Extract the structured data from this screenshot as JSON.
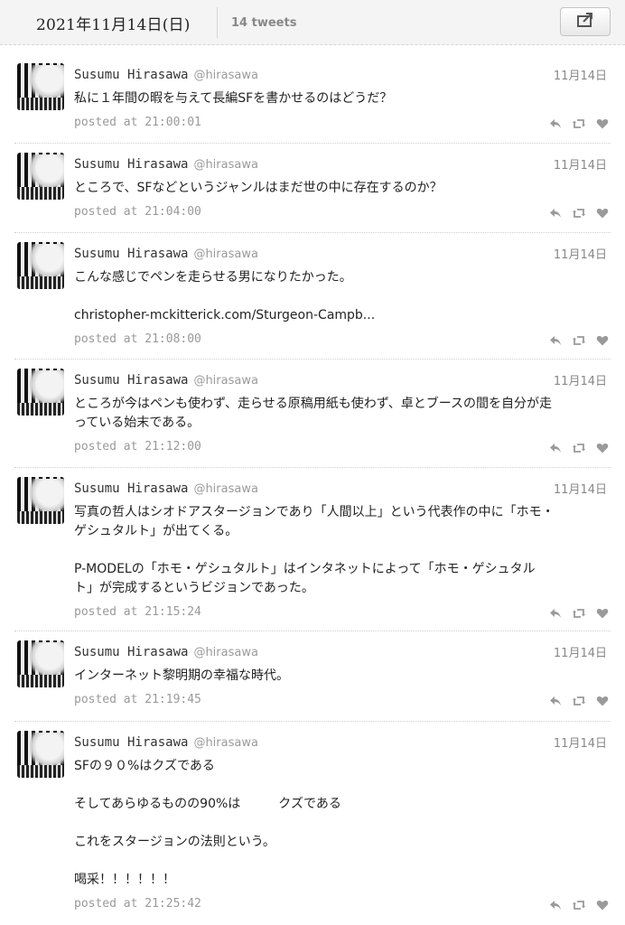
{
  "header": {
    "date_title": "2021年11月14日(日)",
    "tweet_count": "14 tweets",
    "share_icon": "share-icon"
  },
  "tweets": [
    {
      "name": "Susumu Hirasawa",
      "handle": "@hirasawa",
      "date": "11月14日",
      "lines": [
        "私に１年間の暇を与えて長編SFを書かせるのはどうだ？"
      ],
      "posted": "posted at 21:00:01"
    },
    {
      "name": "Susumu Hirasawa",
      "handle": "@hirasawa",
      "date": "11月14日",
      "lines": [
        "ところで、SFなどというジャンルはまだ世の中に存在するのか？"
      ],
      "posted": "posted at 21:04:00"
    },
    {
      "name": "Susumu Hirasawa",
      "handle": "@hirasawa",
      "date": "11月14日",
      "lines": [
        "こんな感じでペンを走らせる男になりたかった。",
        "",
        "christopher-mckitterick.com/Sturgeon-Campb..."
      ],
      "posted": "posted at 21:08:00"
    },
    {
      "name": "Susumu Hirasawa",
      "handle": "@hirasawa",
      "date": "11月14日",
      "lines": [
        "ところが今はペンも使わず、走らせる原稿用紙も使わず、卓とブースの間を自分が走",
        "っている始末である。"
      ],
      "posted": "posted at 21:12:00"
    },
    {
      "name": "Susumu Hirasawa",
      "handle": "@hirasawa",
      "date": "11月14日",
      "lines": [
        "写真の哲人はシオドアスタージョンであり「人間以上」という代表作の中に「ホモ・",
        "ゲシュタルト」が出てくる。",
        "",
        "P-MODELの「ホモ・ゲシュタルト」はインタネットによって「ホモ・ゲシュタル",
        "ト」が完成するというビジョンであった。"
      ],
      "posted": "posted at 21:15:24"
    },
    {
      "name": "Susumu Hirasawa",
      "handle": "@hirasawa",
      "date": "11月14日",
      "lines": [
        "インターネット黎明期の幸福な時代。"
      ],
      "posted": "posted at 21:19:45"
    },
    {
      "name": "Susumu Hirasawa",
      "handle": "@hirasawa",
      "date": "11月14日",
      "lines": [
        "SFの９０%はクズである",
        "",
        "そしてあらゆるものの90%は　　　クズである",
        "",
        "これをスタージョンの法則という。",
        "",
        "喝采！！！！！！"
      ],
      "posted": "posted at 21:25:42"
    }
  ],
  "icons": {
    "reply": "reply-icon",
    "retweet": "retweet-icon",
    "like": "heart-icon"
  }
}
